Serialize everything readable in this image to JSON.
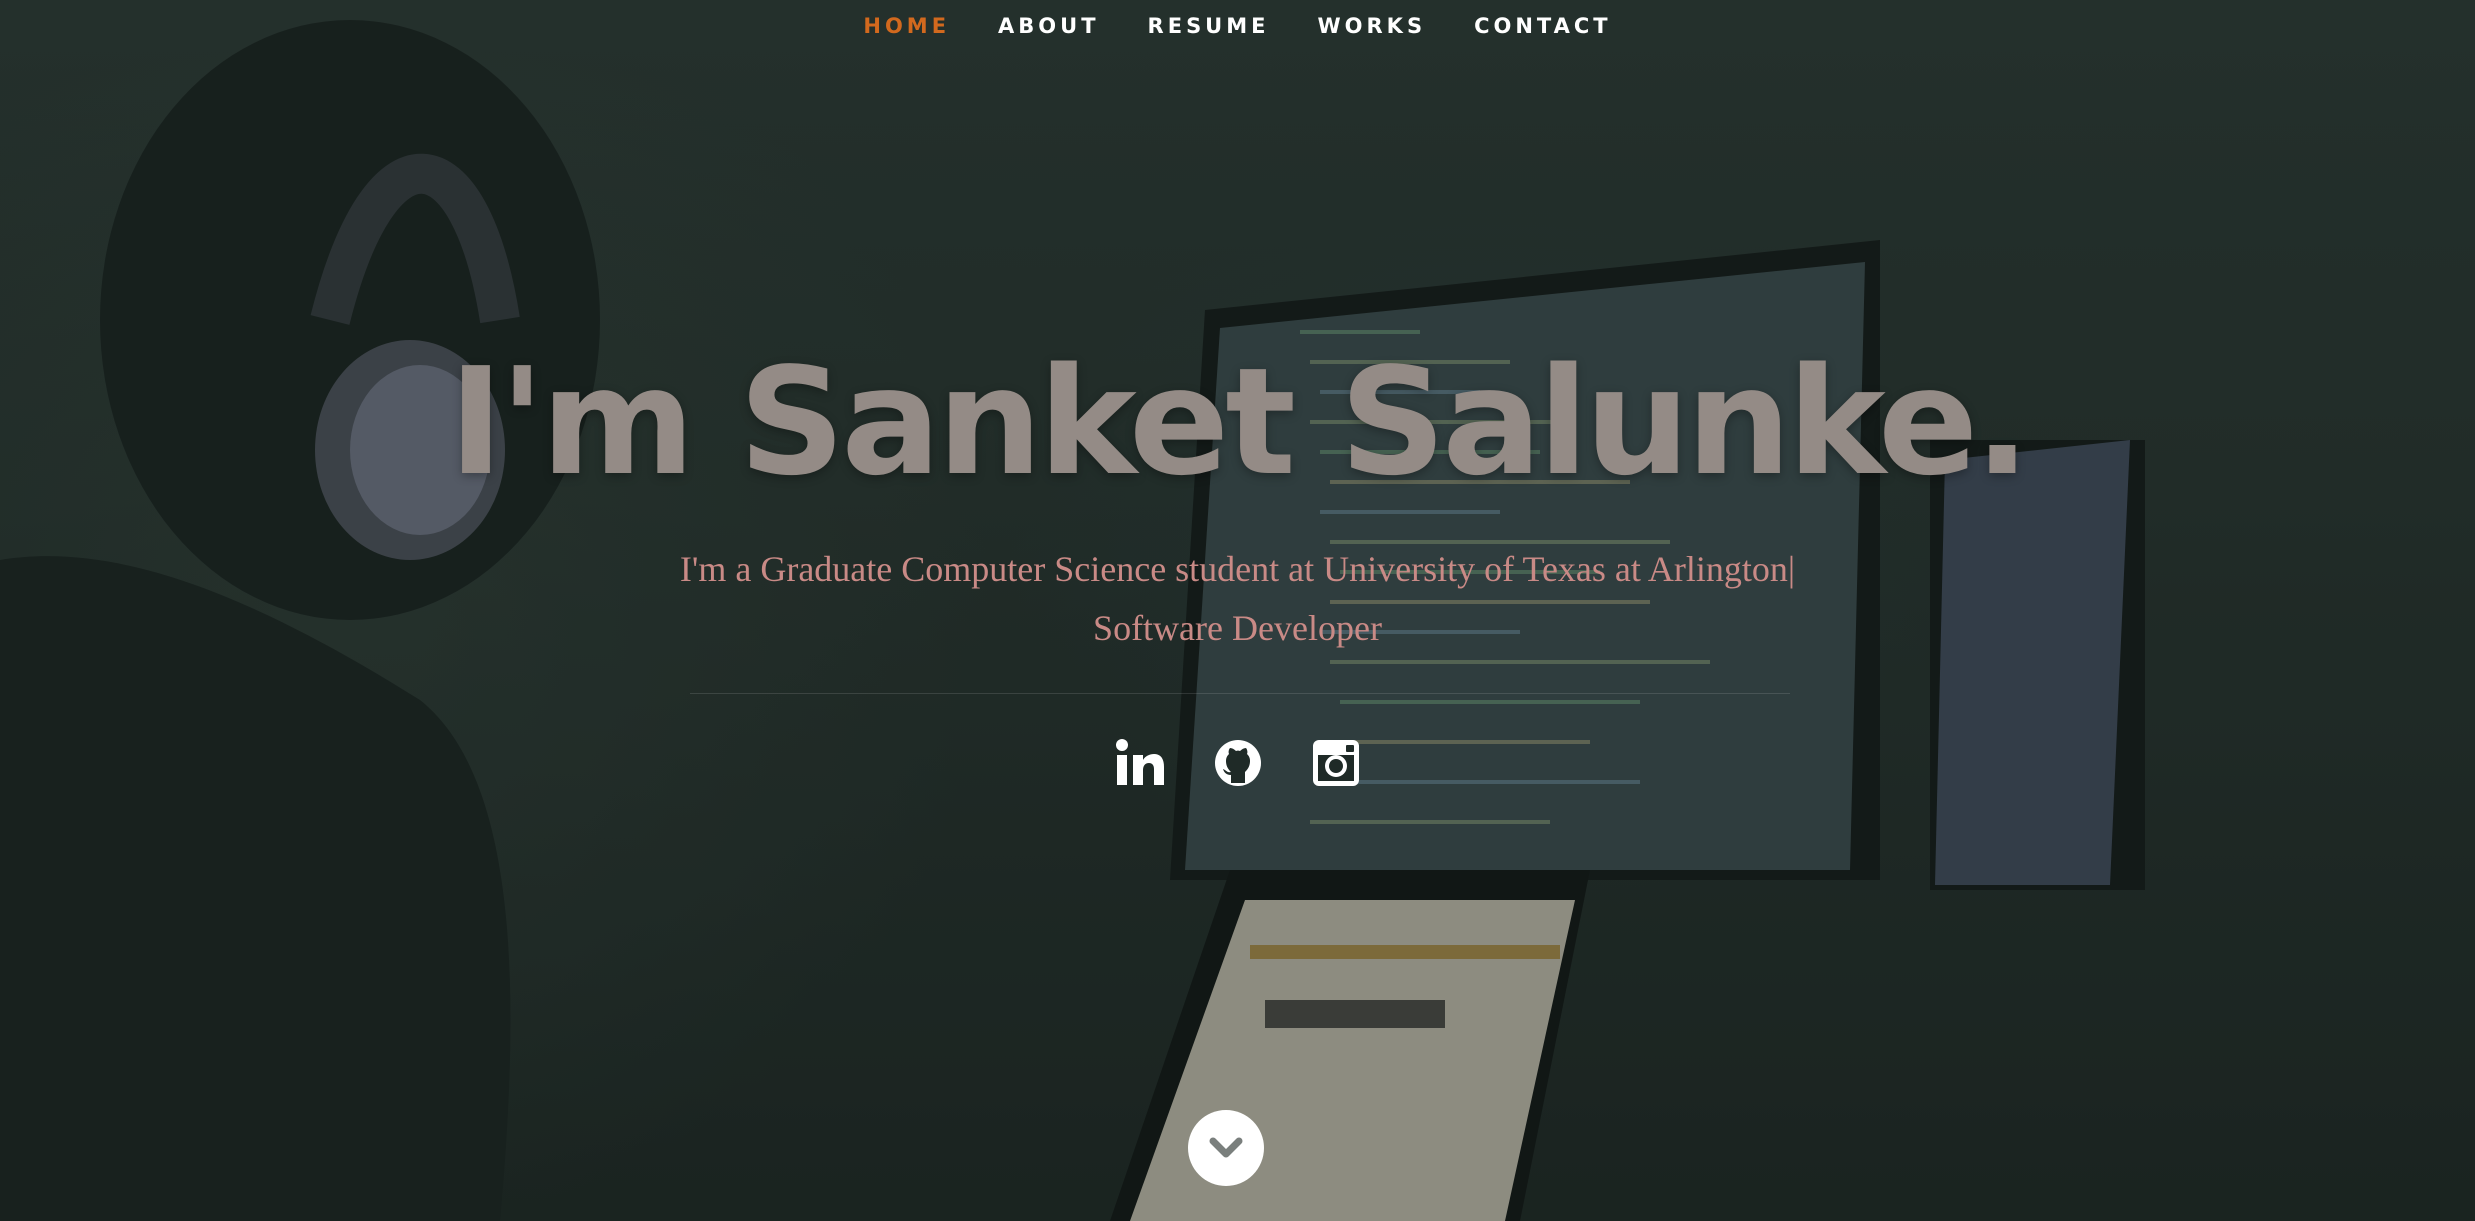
{
  "nav": {
    "items": [
      {
        "label": "HOME",
        "current": true
      },
      {
        "label": "ABOUT",
        "current": false
      },
      {
        "label": "RESUME",
        "current": false
      },
      {
        "label": "WORKS",
        "current": false
      },
      {
        "label": "CONTACT",
        "current": false
      }
    ],
    "active_color": "#d2691e"
  },
  "hero": {
    "headline": "I'm Sanket Salunke.",
    "subtitle_line1": "I'm a Graduate Computer Science student at University of Texas at Arlington|",
    "subtitle_line2": "Software Developer"
  },
  "social": [
    {
      "name": "linkedin-icon"
    },
    {
      "name": "github-icon"
    },
    {
      "name": "instagram-icon"
    }
  ],
  "colors": {
    "headline": "#948b86",
    "subtitle": "#c98a86",
    "background": "#27332f"
  },
  "scroll_button": {
    "icon": "chevron-down-icon"
  }
}
